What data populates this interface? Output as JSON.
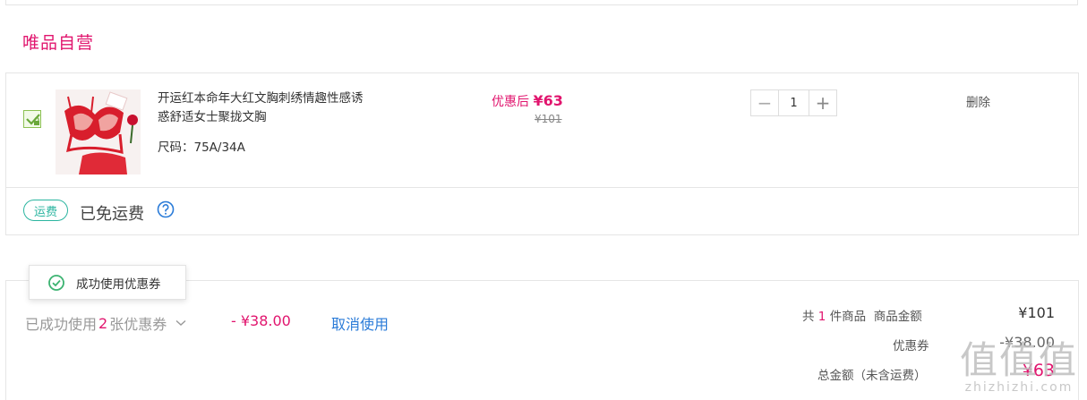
{
  "store": {
    "title": "唯品自营"
  },
  "item": {
    "name": "开运红本命年大红文胸刺绣情趣性感诱惑舒适女士聚拢文胸",
    "size": "尺码：75A/34A",
    "price_label": "优惠后",
    "price_now": "¥63",
    "price_old": "¥101",
    "quantity": "1",
    "decrement": "−",
    "increment": "+",
    "delete_label": "删除",
    "checked": true
  },
  "shipping": {
    "badge": "运费",
    "text": "已免运费"
  },
  "toast": {
    "text": "成功使用优惠券"
  },
  "coupon": {
    "prefix": "已成功使用",
    "count": "2",
    "suffix": "张优惠券",
    "amount": "- ¥38.00",
    "cancel_label": "取消使用"
  },
  "summary": {
    "count_prefix": "共",
    "count": "1",
    "count_suffix": "件商品",
    "goods_amount_label": "商品金额",
    "goods_amount": "¥101",
    "discount_label": "优惠券",
    "discount": "-¥38.00",
    "total_label": "总金额（未含运费）",
    "total": "¥63"
  },
  "watermark": {
    "big": "值值值",
    "small": "zhizhizhi.com"
  },
  "colors": {
    "brand": "#e1156e",
    "link": "#2a7bd8",
    "shipping_badge": "#2bb5a0",
    "checkbox": "#8cc152"
  }
}
